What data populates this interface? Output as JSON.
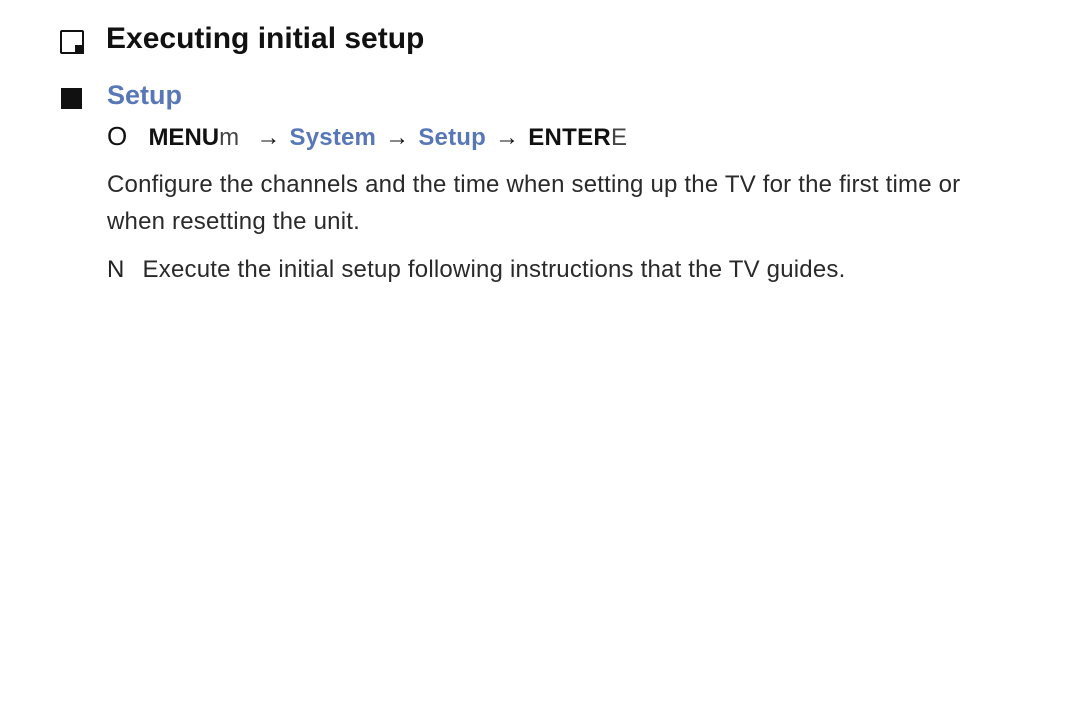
{
  "title": "Executing initial setup",
  "section": {
    "heading": "Setup"
  },
  "breadcrumb": {
    "o_marker": "O",
    "menu_label": "MENU",
    "menu_suffix": "m",
    "arrow": "→",
    "system_label": "System",
    "setup_label": "Setup",
    "enter_label": "ENTER",
    "enter_suffix": "E"
  },
  "paragraph": "Configure the channels and the time when setting up the TV for the first time or when resetting the unit.",
  "note": {
    "marker": "N",
    "text": "Execute the initial setup following instructions that the TV guides."
  }
}
